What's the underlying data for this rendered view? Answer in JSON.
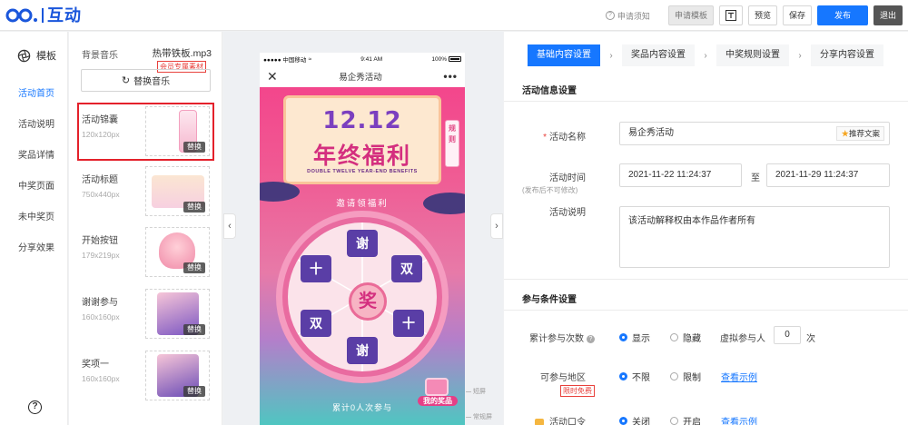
{
  "app": {
    "logo_text": "互动",
    "brand_color": "#1a56db"
  },
  "topbar": {
    "help_label": "申请须知",
    "apply_template_label": "申请模板",
    "preview_label": "预览",
    "save_label": "保存",
    "publish_label": "发布",
    "exit_label": "退出"
  },
  "leftnav": {
    "header_label": "模板",
    "items": [
      {
        "label": "活动首页",
        "active": true
      },
      {
        "label": "活动说明",
        "active": false
      },
      {
        "label": "奖品详情",
        "active": false
      },
      {
        "label": "中奖页面",
        "active": false
      },
      {
        "label": "未中奖页",
        "active": false
      },
      {
        "label": "分享效果",
        "active": false
      }
    ],
    "help_glyph": "?"
  },
  "materials": {
    "music_label": "背景音乐",
    "music_file": "热带铁板.mp3",
    "vip_tag": "会员专属素材",
    "replace_music_label": "替换音乐",
    "swap_label": "替换",
    "items": [
      {
        "name": "活动锦囊",
        "size": "120x120px"
      },
      {
        "name": "活动标题",
        "size": "750x440px"
      },
      {
        "name": "开始按钮",
        "size": "179x219px"
      },
      {
        "name": "谢谢参与",
        "size": "160x160px"
      },
      {
        "name": "奖项一",
        "size": "160x160px"
      }
    ]
  },
  "phone": {
    "carrier": "●●●●● 中国移动",
    "time": "9:41 AM",
    "battery": "100%",
    "title": "易企秀活动",
    "banner_top": "12.12",
    "banner_main": "年终福利",
    "banner_sub": "DOUBLE TWELVE YEAR-END BENEFITS",
    "rule_tag": "规则",
    "invite_text": "邀请领福利",
    "hub_text": "奖",
    "counter_text": "累计0人次参与",
    "my_prize": "我的奖品",
    "marker_short": "短屏",
    "marker_normal": "常规屏"
  },
  "settings": {
    "steps": [
      "基础内容设置",
      "奖品内容设置",
      "中奖规则设置",
      "分享内容设置"
    ],
    "section_activity": "活动信息设置",
    "name_label": "活动名称",
    "name_value": "易企秀活动",
    "recommend_label": "推荐文案",
    "time_label": "活动时间",
    "time_note": "(发布后不可修改)",
    "start_time": "2021-11-22 11:24:37",
    "to_label": "至",
    "end_time": "2021-11-29 11:24:37",
    "desc_label": "活动说明",
    "desc_value": "该活动解释权由本作品作者所有",
    "section_participation": "参与条件设置",
    "count_label": "累计参与次数",
    "count_show": "显示",
    "count_hide": "隐藏",
    "virtual_label": "虚拟参与人",
    "virtual_value": "0",
    "virtual_unit": "次",
    "region_label": "可参与地区",
    "region_unlimited": "不限",
    "region_limited": "限制",
    "view_example": "查看示例",
    "free_tag": "限时免费",
    "password_label": "活动口令",
    "password_off": "关闭",
    "password_on": "开启"
  }
}
